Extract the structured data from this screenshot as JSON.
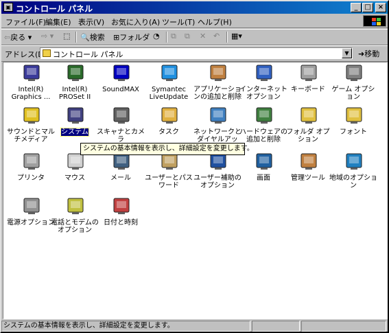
{
  "window": {
    "title": "コントロール パネル"
  },
  "menu": [
    "ファイル(F)",
    "編集(E)",
    "表示(V)",
    "お気に入り(A)",
    "ツール(T)",
    "ヘルプ(H)"
  ],
  "toolbar": {
    "back": "戻る",
    "search": "検索",
    "folders": "フォルダ"
  },
  "address": {
    "label": "アドレス(D)",
    "value": "コントロール パネル",
    "go": "移動"
  },
  "items": [
    {
      "label": "Intel(R) Graphics ...",
      "icon": "intel-graphics-icon"
    },
    {
      "label": "Intel(R) PROSet II",
      "icon": "intel-proset-icon"
    },
    {
      "label": "SoundMAX",
      "icon": "soundmax-icon"
    },
    {
      "label": "Symantec LiveUpdate",
      "icon": "liveupdate-icon"
    },
    {
      "label": "アプリケーションの追加と削除",
      "icon": "add-remove-programs-icon"
    },
    {
      "label": "インターネット オプション",
      "icon": "internet-options-icon"
    },
    {
      "label": "キーボード",
      "icon": "keyboard-icon"
    },
    {
      "label": "ゲーム オプション",
      "icon": "game-options-icon"
    },
    {
      "label": "サウンドとマルチメディア",
      "icon": "sound-multimedia-icon"
    },
    {
      "label": "システム",
      "icon": "system-icon"
    },
    {
      "label": "スキャナとカメラ",
      "icon": "scanner-camera-icon"
    },
    {
      "label": "タスク",
      "icon": "tasks-icon"
    },
    {
      "label": "ネットワークとダイヤルアップ...",
      "icon": "network-dialup-icon"
    },
    {
      "label": "ハードウェアの追加と削除",
      "icon": "add-hardware-icon"
    },
    {
      "label": "フォルダ オプション",
      "icon": "folder-options-icon"
    },
    {
      "label": "フォント",
      "icon": "fonts-icon"
    },
    {
      "label": "プリンタ",
      "icon": "printers-icon"
    },
    {
      "label": "マウス",
      "icon": "mouse-icon"
    },
    {
      "label": "メール",
      "icon": "mail-icon"
    },
    {
      "label": "ユーザーとパスワード",
      "icon": "users-passwords-icon"
    },
    {
      "label": "ユーザー補助のオプション",
      "icon": "accessibility-icon"
    },
    {
      "label": "画面",
      "icon": "display-icon"
    },
    {
      "label": "管理ツール",
      "icon": "admin-tools-icon"
    },
    {
      "label": "地域のオプション",
      "icon": "regional-options-icon"
    },
    {
      "label": "電源オプション",
      "icon": "power-options-icon"
    },
    {
      "label": "電話とモデムのオプション",
      "icon": "phone-modem-icon"
    },
    {
      "label": "日付と時刻",
      "icon": "date-time-icon"
    }
  ],
  "selected_item": "システム",
  "tooltip": "システムの基本情報を表示し、詳細設定を変更します。",
  "status": {
    "text": "システムの基本情報を表示し、詳細設定を変更します。"
  }
}
